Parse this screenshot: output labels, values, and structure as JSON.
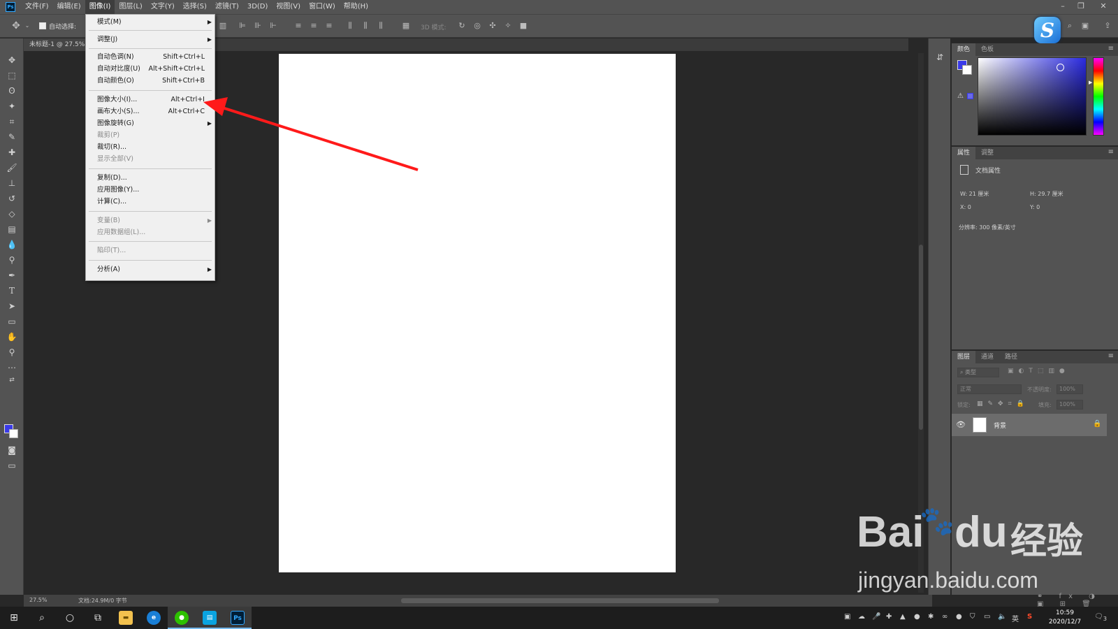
{
  "menubar": {
    "app_icon": "Ps",
    "items": [
      "文件(F)",
      "编辑(E)",
      "图像(I)",
      "图层(L)",
      "文字(Y)",
      "选择(S)",
      "滤镜(T)",
      "3D(D)",
      "视图(V)",
      "窗口(W)",
      "帮助(H)"
    ],
    "active_index": 2
  },
  "options": {
    "auto_select_label": "自动选择:",
    "mode_3d_label": "3D 模式:"
  },
  "document": {
    "tab_title": "未标题-1 @ 27.5%"
  },
  "image_menu": {
    "items": [
      {
        "label": "模式(M)",
        "shortcut": "",
        "submenu": true,
        "disabled": false
      },
      {
        "label": "调整(J)",
        "shortcut": "",
        "submenu": true,
        "disabled": false
      },
      {
        "label": "自动色调(N)",
        "shortcut": "Shift+Ctrl+L",
        "submenu": false,
        "disabled": false
      },
      {
        "label": "自动对比度(U)",
        "shortcut": "Alt+Shift+Ctrl+L",
        "submenu": false,
        "disabled": false
      },
      {
        "label": "自动颜色(O)",
        "shortcut": "Shift+Ctrl+B",
        "submenu": false,
        "disabled": false
      },
      {
        "label": "图像大小(I)...",
        "shortcut": "Alt+Ctrl+I",
        "submenu": false,
        "disabled": false
      },
      {
        "label": "画布大小(S)...",
        "shortcut": "Alt+Ctrl+C",
        "submenu": false,
        "disabled": false
      },
      {
        "label": "图像旋转(G)",
        "shortcut": "",
        "submenu": true,
        "disabled": false
      },
      {
        "label": "裁剪(P)",
        "shortcut": "",
        "submenu": false,
        "disabled": true
      },
      {
        "label": "裁切(R)...",
        "shortcut": "",
        "submenu": false,
        "disabled": false
      },
      {
        "label": "显示全部(V)",
        "shortcut": "",
        "submenu": false,
        "disabled": true
      },
      {
        "label": "复制(D)...",
        "shortcut": "",
        "submenu": false,
        "disabled": false
      },
      {
        "label": "应用图像(Y)...",
        "shortcut": "",
        "submenu": false,
        "disabled": false
      },
      {
        "label": "计算(C)...",
        "shortcut": "",
        "submenu": false,
        "disabled": false
      },
      {
        "label": "变量(B)",
        "shortcut": "",
        "submenu": true,
        "disabled": true
      },
      {
        "label": "应用数据组(L)...",
        "shortcut": "",
        "submenu": false,
        "disabled": true
      },
      {
        "label": "陷印(T)...",
        "shortcut": "",
        "submenu": false,
        "disabled": true
      },
      {
        "label": "分析(A)",
        "shortcut": "",
        "submenu": true,
        "disabled": false
      }
    ]
  },
  "annotation": {
    "color": "#ff1a1a"
  },
  "status": {
    "zoom": "27.5%",
    "doc_info": "文档:24.9M/0 字节"
  },
  "color_panel": {
    "tabs": [
      "颜色",
      "色板"
    ],
    "foreground": "#3a3ae8",
    "background": "#ffffff"
  },
  "properties_panel": {
    "tabs": [
      "属性",
      "调整"
    ],
    "title": "文档属性",
    "w": "W: 21 厘米",
    "h": "H: 29.7 厘米",
    "x": "X: 0",
    "y": "Y: 0",
    "resolution": "分辨率: 300 像素/英寸"
  },
  "layers_panel": {
    "tabs": [
      "图层",
      "通道",
      "路径"
    ],
    "search_placeholder": "类型",
    "blend_mode": "正常",
    "opacity_label": "不透明度:",
    "opacity_value": "100%",
    "lock_label": "锁定:",
    "fill_label": "填充:",
    "fill_value": "100%",
    "layer_name": "背景"
  },
  "taskbar": {
    "time": "10:59",
    "date": "2020/12/7",
    "ime": "英",
    "notification_count": "3"
  },
  "watermark": {
    "brand": "Bai",
    "brand2": "du",
    "cn": "经验",
    "url": "jingyan.baidu.com"
  }
}
